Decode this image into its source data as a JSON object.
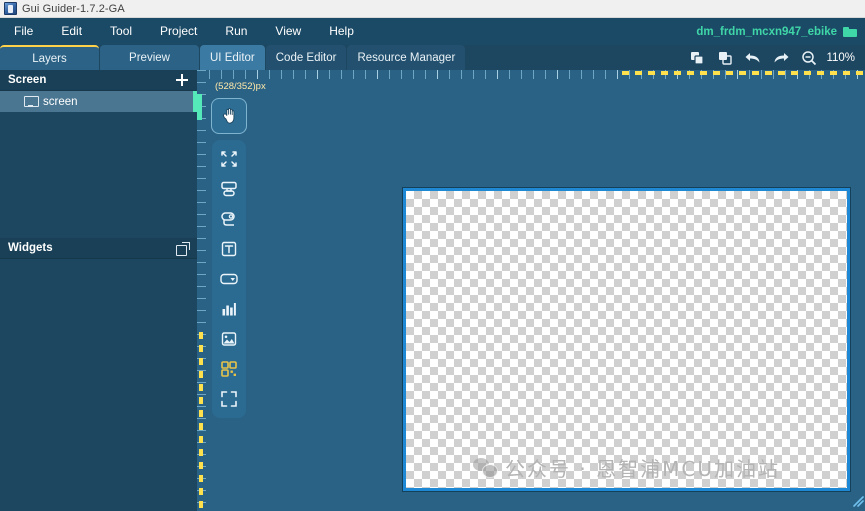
{
  "window": {
    "title": "Gui Guider-1.7.2-GA",
    "app_icon": "app-icon"
  },
  "menubar": {
    "items": [
      {
        "label": "File"
      },
      {
        "label": "Edit"
      },
      {
        "label": "Tool"
      },
      {
        "label": "Project"
      },
      {
        "label": "Run"
      },
      {
        "label": "View"
      },
      {
        "label": "Help"
      }
    ],
    "project": {
      "name": "dm_frdm_mcxn947_ebike",
      "icon": "folder-icon",
      "color": "#3fd6a8"
    }
  },
  "tabs": {
    "left_group": [
      {
        "label": "Layers",
        "active": true
      },
      {
        "label": "Preview",
        "active": false
      }
    ],
    "right_group": [
      {
        "label": "UI Editor",
        "active": true
      },
      {
        "label": "Code Editor",
        "active": false
      },
      {
        "label": "Resource Manager",
        "active": false
      }
    ]
  },
  "toolbar": {
    "buttons": [
      {
        "name": "copy-icon",
        "title": "Copy"
      },
      {
        "name": "paste-icon",
        "title": "Paste"
      },
      {
        "name": "undo-icon",
        "title": "Undo"
      },
      {
        "name": "redo-icon",
        "title": "Redo"
      },
      {
        "name": "zoom-out-icon",
        "title": "Zoom out"
      }
    ],
    "zoom_level": "110%"
  },
  "sidebar": {
    "screen_panel": {
      "title": "Screen",
      "add_label": "+",
      "items": [
        {
          "label": "screen",
          "icon": "monitor-icon",
          "selected": true
        }
      ]
    },
    "widgets_panel": {
      "title": "Widgets",
      "popout_icon": "popout-icon"
    }
  },
  "editor": {
    "coordinate_label": "(528/352)px",
    "palette_primary": {
      "name": "pointer-hand-tool",
      "label": "Select"
    },
    "palette_tools": [
      {
        "name": "resize-tool",
        "label": "Resize"
      },
      {
        "name": "container-tool",
        "label": "Container"
      },
      {
        "name": "stack-tool",
        "label": "Stack"
      },
      {
        "name": "text-tool",
        "label": "Text"
      },
      {
        "name": "dropdown-tool",
        "label": "Dropdown"
      },
      {
        "name": "chart-tool",
        "label": "Chart"
      },
      {
        "name": "image-tool",
        "label": "Image"
      },
      {
        "name": "qrcode-tool",
        "label": "QR Code"
      },
      {
        "name": "fullscreen-tool",
        "label": "Fit to screen"
      }
    ],
    "canvas": {
      "selected": true,
      "selection_color": "#1f88d4",
      "watermark_text": "公众号 · 恩智浦MCU加油站",
      "watermark_icon": "wechat-icon"
    }
  },
  "colors": {
    "window_chrome": "#1b4a66",
    "panel_bg": "#1d4660",
    "canvas_bg": "#2a6286",
    "accent_yellow": "#ffd24a",
    "accent_teal": "#55e8b8",
    "selection_blue": "#1f88d4"
  }
}
